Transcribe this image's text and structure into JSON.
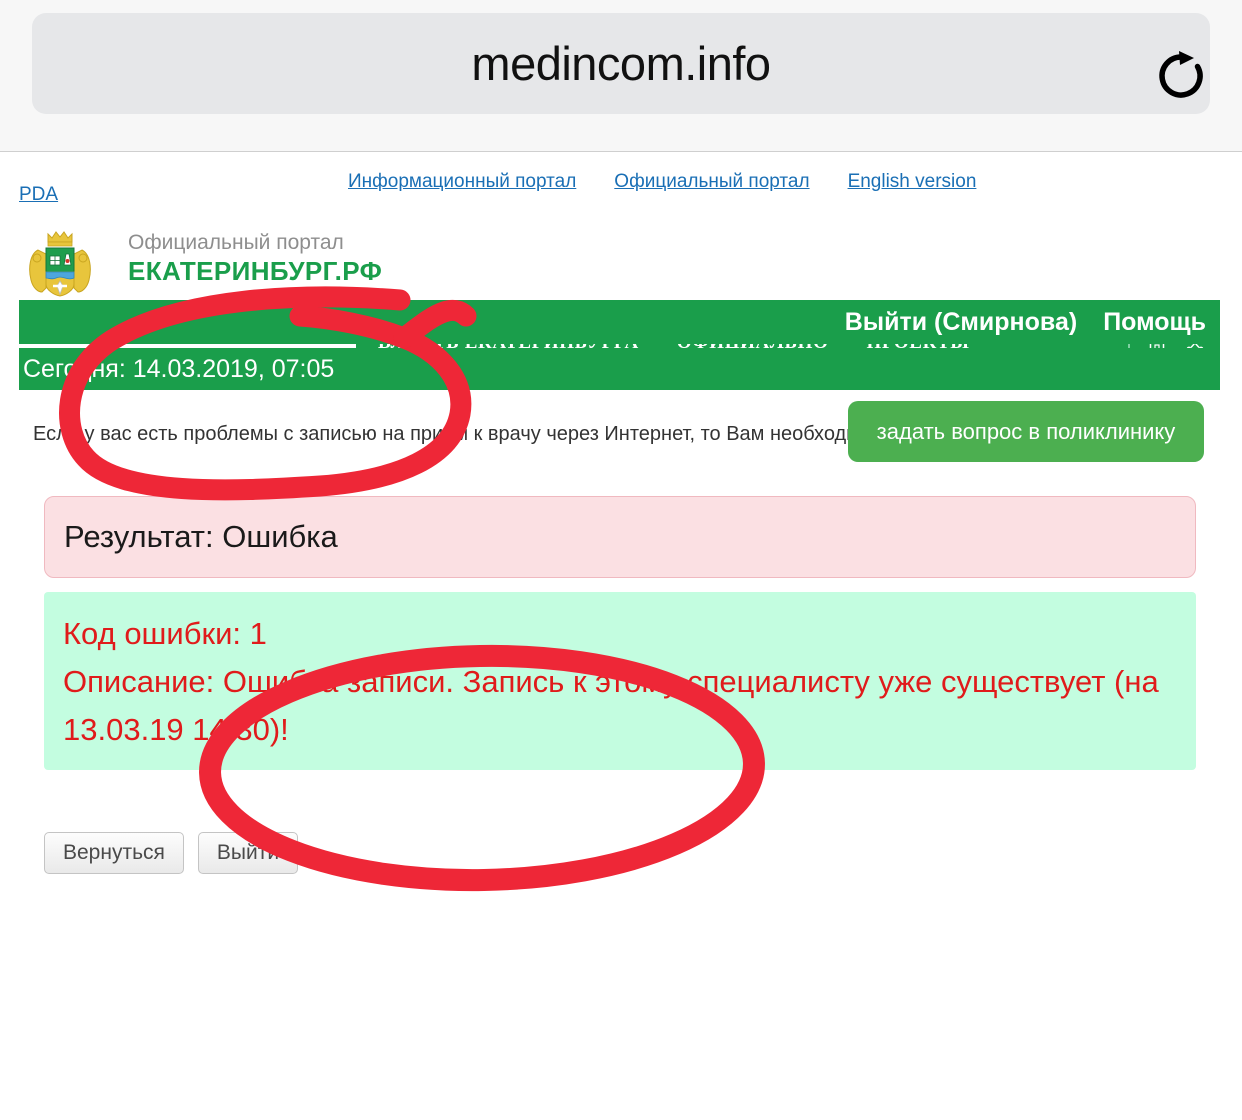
{
  "browser": {
    "url": "medincom.info",
    "reload_icon": "reload-icon"
  },
  "top_links": {
    "pda": "PDA",
    "items": [
      "Информационный портал",
      "Официальный портал",
      "English version"
    ]
  },
  "logo": {
    "line1": "Официальный портал",
    "line2": "ЕКАТЕРИНБУРГ.РФ",
    "crest_icon": "coat-of-arms-icon"
  },
  "main_nav": {
    "items": [
      "ВЛАСТЬ ЕКАТЕРИНБУРГА",
      "ОФИЦИАЛЬНО",
      "ПРОЕКТЫ"
    ],
    "icons": [
      "home-icon",
      "sitemap-icon"
    ]
  },
  "user_bar": {
    "logout": "Выйти (Смирнова)",
    "help": "Помощь"
  },
  "date_bar": {
    "text": "Сегодня: 14.03.2019, 07:05"
  },
  "info": {
    "text": "Если у вас есть проблемы с записью на прием к врачу через Интернет, то Вам необходимо",
    "button": "задать вопрос в поликлинику"
  },
  "result": {
    "text": "Результат: Ошибка"
  },
  "error": {
    "code_line": "Код ошибки: 1",
    "description_line": "Описание: Ошибка записи. Запись к этому специалисту уже существует (на 13.03.19 14:30)!"
  },
  "buttons": {
    "back": "Вернуться",
    "exit": "Выйти"
  },
  "colors": {
    "brand_green": "#1a9e4b",
    "button_green": "#4caf50",
    "result_pink": "#fbe0e3",
    "error_mint": "#c3fde0",
    "error_red_text": "#e01b1b",
    "annotation_red": "#ee2737",
    "link_blue": "#1a6fb5"
  }
}
